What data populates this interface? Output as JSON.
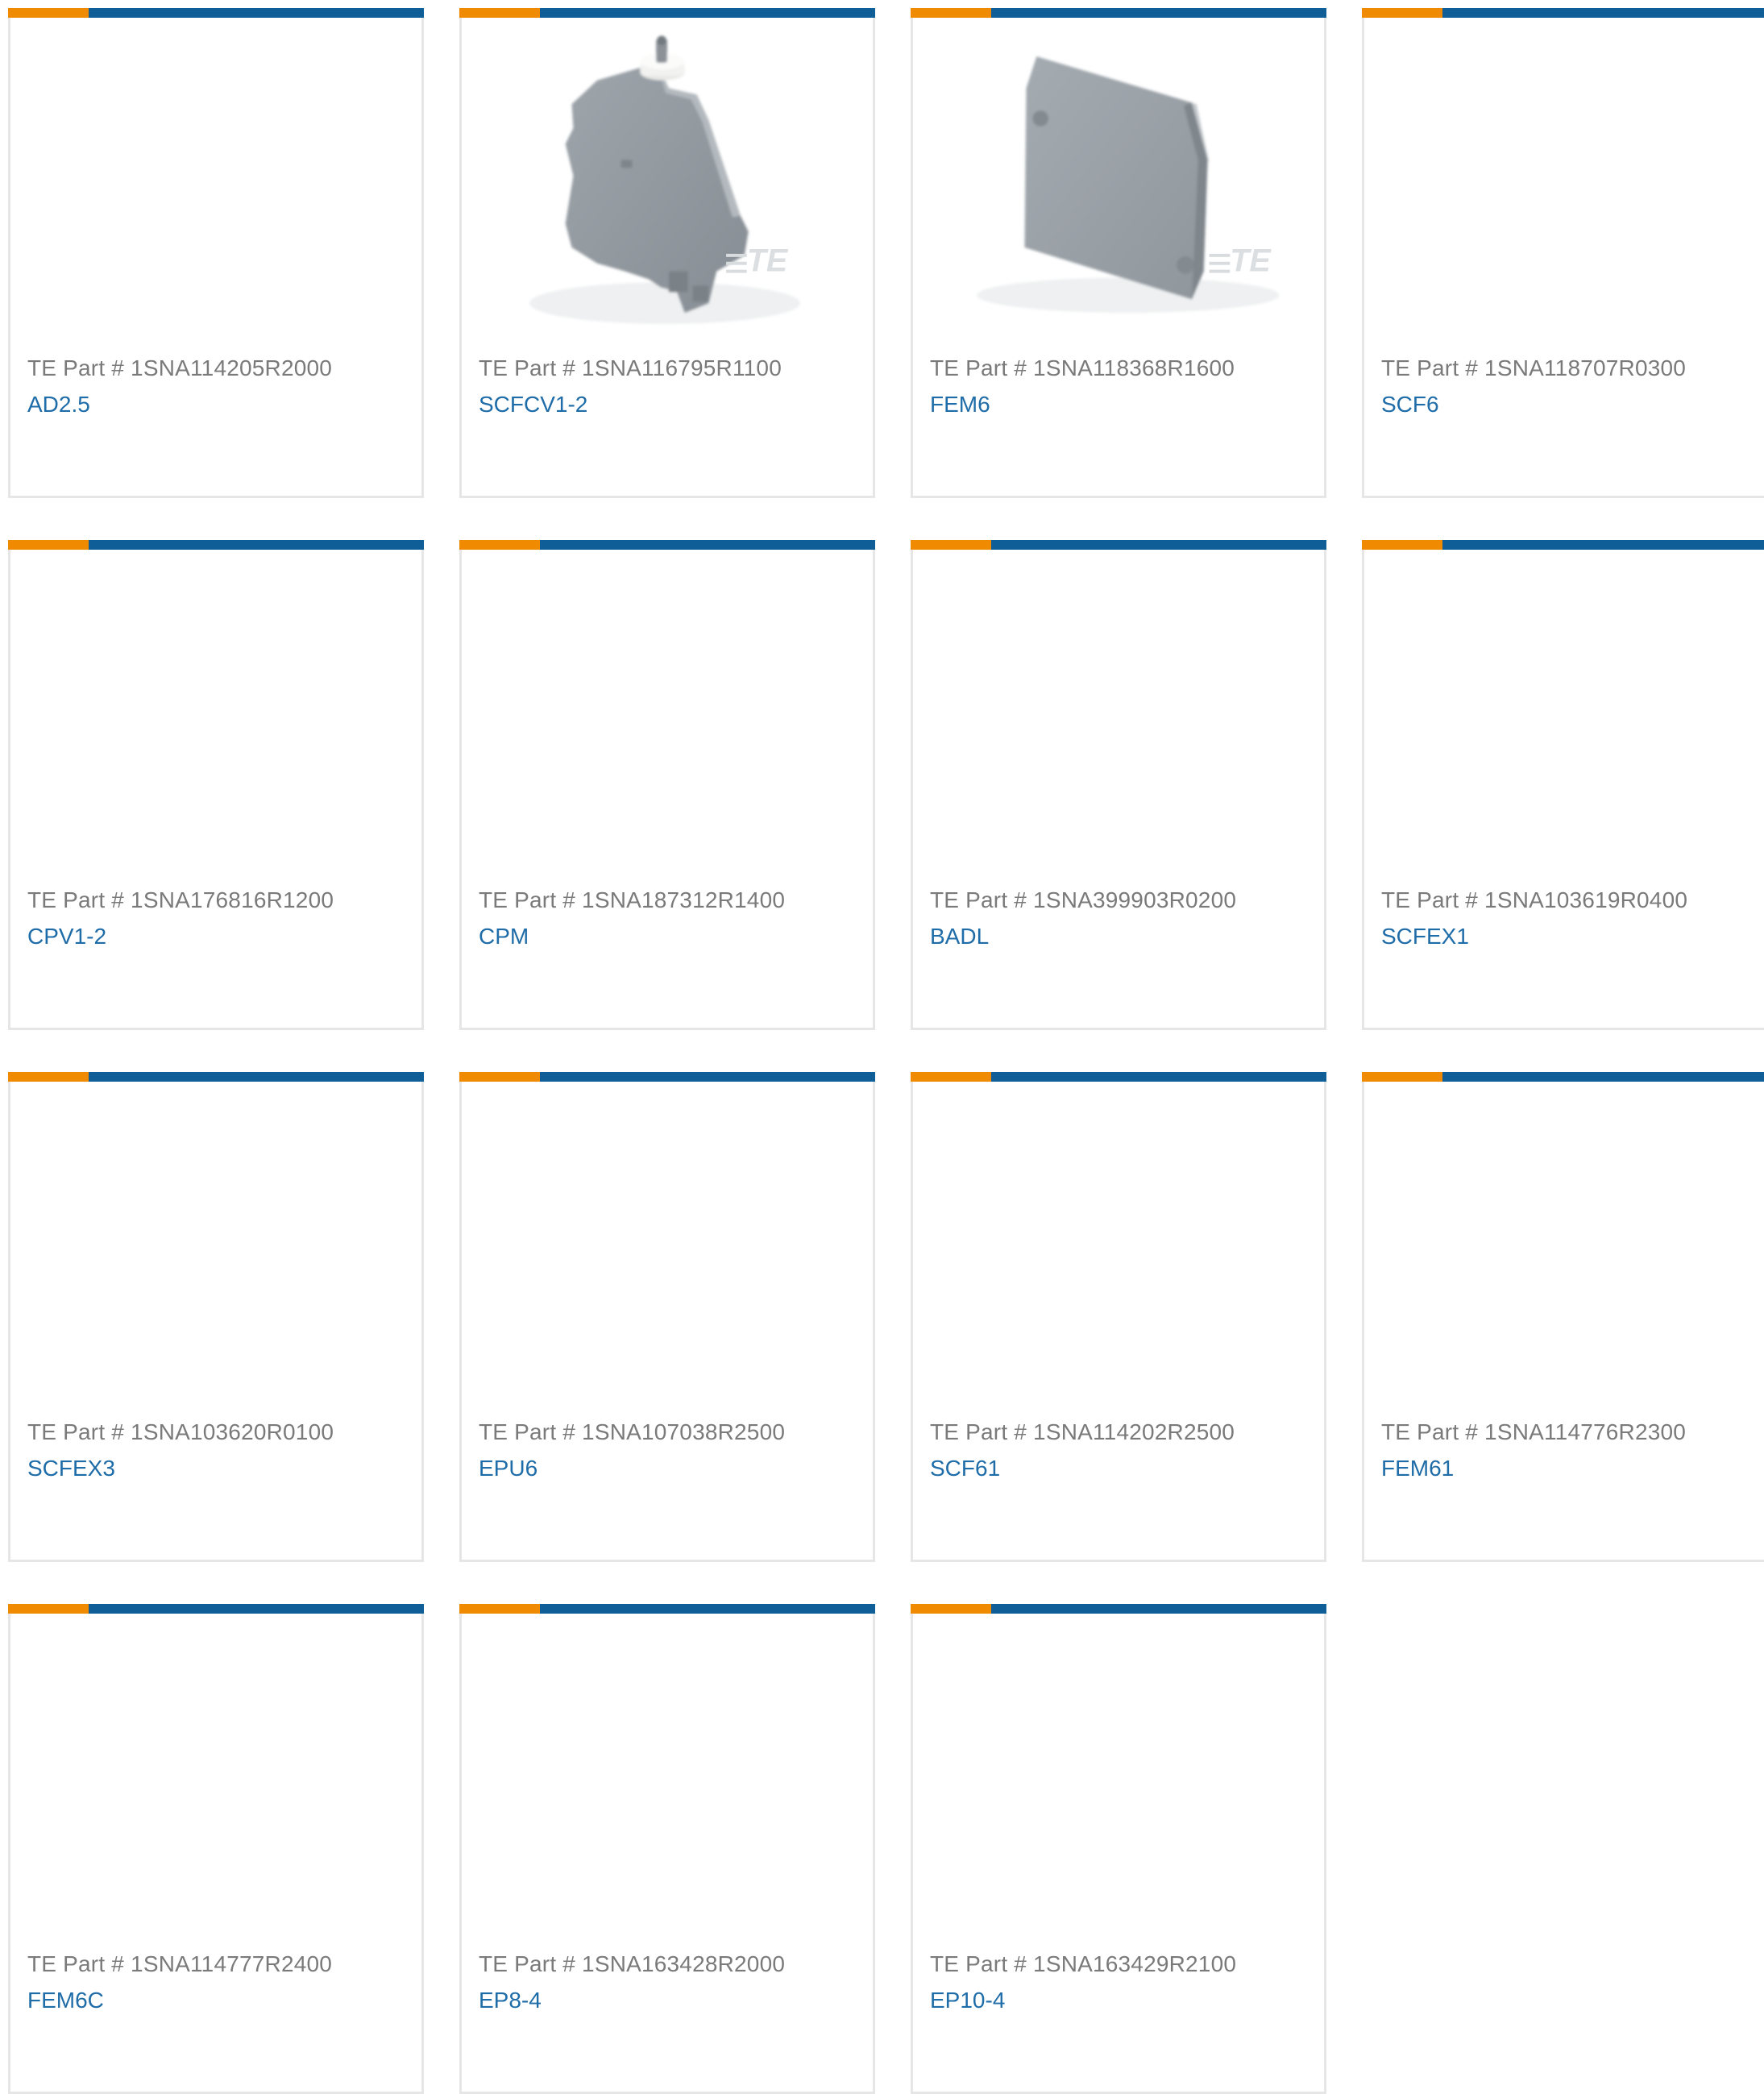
{
  "theme": {
    "accent_orange": "#f08a00",
    "accent_blue": "#0f5e98",
    "link_color": "#1e6ca8",
    "label_color": "#7a7a7a",
    "border_color": "#e6e6e6"
  },
  "products": [
    {
      "part_label": "TE Part # 1SNA114205R2000",
      "name": "AD2.5",
      "image": "none"
    },
    {
      "part_label": "TE Part # 1SNA116795R1100",
      "name": "SCFCV1-2",
      "image": "end-section-with-knob",
      "watermark": "TE"
    },
    {
      "part_label": "TE Part # 1SNA118368R1600",
      "name": "FEM6",
      "image": "end-plate",
      "watermark": "TE"
    },
    {
      "part_label": "TE Part # 1SNA118707R0300",
      "name": "SCF6",
      "image": "none"
    },
    {
      "part_label": "TE Part # 1SNA176816R1200",
      "name": "CPV1-2",
      "image": "none"
    },
    {
      "part_label": "TE Part # 1SNA187312R1400",
      "name": "CPM",
      "image": "none"
    },
    {
      "part_label": "TE Part # 1SNA399903R0200",
      "name": "BADL",
      "image": "none"
    },
    {
      "part_label": "TE Part # 1SNA103619R0400",
      "name": "SCFEX1",
      "image": "none"
    },
    {
      "part_label": "TE Part # 1SNA103620R0100",
      "name": "SCFEX3",
      "image": "none"
    },
    {
      "part_label": "TE Part # 1SNA107038R2500",
      "name": "EPU6",
      "image": "none"
    },
    {
      "part_label": "TE Part # 1SNA114202R2500",
      "name": "SCF61",
      "image": "none"
    },
    {
      "part_label": "TE Part # 1SNA114776R2300",
      "name": "FEM61",
      "image": "none"
    },
    {
      "part_label": "TE Part # 1SNA114777R2400",
      "name": "FEM6C",
      "image": "none"
    },
    {
      "part_label": "TE Part # 1SNA163428R2000",
      "name": "EP8-4",
      "image": "none"
    },
    {
      "part_label": "TE Part # 1SNA163429R2100",
      "name": "EP10-4",
      "image": "none"
    }
  ]
}
